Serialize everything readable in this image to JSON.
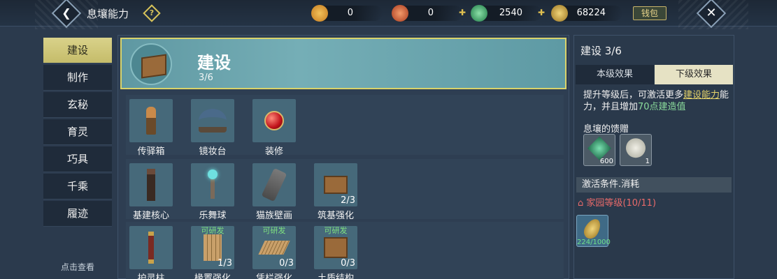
{
  "topbar": {
    "back_glyph": "❮",
    "title": "息壤能力",
    "help_glyph": "?",
    "resources": [
      {
        "icon": "orange-coin-icon",
        "value": "0",
        "color": "#d9962e",
        "plus": ""
      },
      {
        "icon": "red-spiral-coin-icon",
        "value": "0",
        "color": "#c9502e",
        "plus": "✚"
      },
      {
        "icon": "jade-ring-icon",
        "value": "2540",
        "color": "#3fae6a",
        "plus": "✚"
      },
      {
        "icon": "gold-leaf-icon",
        "value": "68224",
        "color": "#c9a03e",
        "plus": ""
      }
    ],
    "wallet_label": "钱包",
    "close_glyph": "✕"
  },
  "nav": {
    "items": [
      {
        "label": "建设",
        "active": true
      },
      {
        "label": "制作",
        "active": false
      },
      {
        "label": "玄秘",
        "active": false
      },
      {
        "label": "育灵",
        "active": false
      },
      {
        "label": "巧具",
        "active": false
      },
      {
        "label": "千乘",
        "active": false
      },
      {
        "label": "履迹",
        "active": false
      }
    ],
    "footer": "点击查看"
  },
  "header": {
    "title": "建设",
    "progress": "3/6",
    "icon": "wooden-crate-icon"
  },
  "grid": {
    "row1": [
      {
        "label": "传驿箱",
        "icon": "lantern-post-icon",
        "tag": "",
        "research": ""
      },
      {
        "label": "镜妆台",
        "icon": "mirror-stand-icon",
        "tag": "",
        "research": ""
      },
      {
        "label": "装修",
        "icon": "red-orb-icon",
        "tag": "",
        "research": ""
      }
    ],
    "row2": [
      {
        "label": "基建核心",
        "icon": "totem-pillar-icon",
        "tag": "",
        "research": ""
      },
      {
        "label": "乐舞球",
        "icon": "glowing-orb-stand-icon",
        "tag": "",
        "research": ""
      },
      {
        "label": "猫族壁画",
        "icon": "stone-slab-icon",
        "tag": "",
        "research": ""
      },
      {
        "label": "筑基强化",
        "icon": "wooden-crate-icon",
        "tag": "2/3",
        "research": ""
      }
    ],
    "row3": [
      {
        "label": "护灵柱",
        "icon": "red-pillar-icon",
        "tag": "",
        "research": ""
      },
      {
        "label": "椽置强化",
        "icon": "wooden-planks-icon",
        "tag": "1/3",
        "research": "可研发"
      },
      {
        "label": "凭栏强化",
        "icon": "wooden-ramp-icon",
        "tag": "0/3",
        "research": "可研发"
      },
      {
        "label": "土质结构",
        "icon": "wooden-crate-icon",
        "tag": "0/3",
        "research": "可研发"
      }
    ]
  },
  "right": {
    "title": "建设 3/6",
    "tab_current": "本级效果",
    "tab_next": "下级效果",
    "desc_part1": "提升等级后，可激活更多",
    "desc_link": "建设能力",
    "desc_part2": "能力，并且增加",
    "desc_value": "70点建造值",
    "gift_title": "息壤的馈赠",
    "gifts": [
      {
        "icon": "green-gem-icon",
        "count": "600"
      },
      {
        "icon": "jade-disc-icon",
        "count": "1"
      }
    ],
    "cond_title": "激活条件.消耗",
    "level_req": "家园等级(10/11)",
    "level_icon": "red-house-icon",
    "cost": {
      "icon": "gold-leaf-icon",
      "count": "224/1000"
    }
  }
}
